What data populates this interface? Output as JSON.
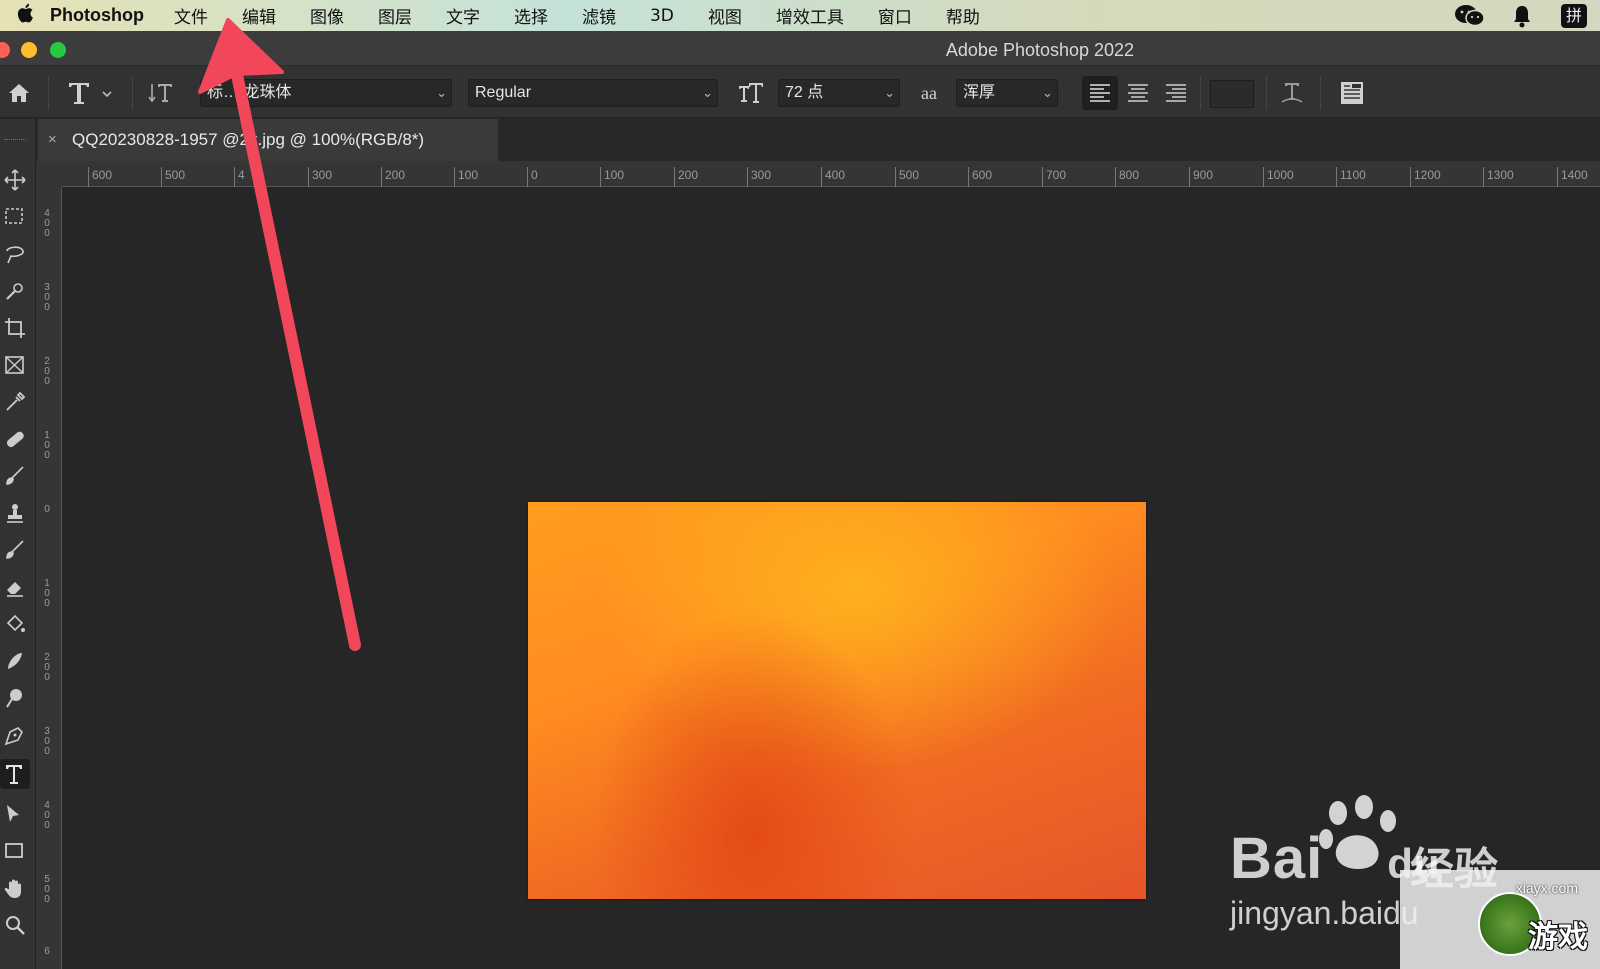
{
  "menubar": {
    "apple_icon": "apple-logo-icon",
    "app_name": "Photoshop",
    "items": [
      "文件",
      "编辑",
      "图像",
      "图层",
      "文字",
      "选择",
      "滤镜",
      "3D",
      "视图",
      "增效工具",
      "窗口",
      "帮助"
    ],
    "right_icons": [
      "wechat-icon",
      "notification-bell-icon",
      "input-method-icon"
    ],
    "input_method_label": "拼"
  },
  "window": {
    "title": "Adobe Photoshop 2022"
  },
  "options_bar": {
    "font_family": "标… 龙珠体",
    "font_style": "Regular",
    "font_size": "72 点",
    "anti_alias_label": "aa",
    "anti_alias": "浑厚",
    "text_color": "#2b2b2b"
  },
  "document_tab": {
    "close_label": "×",
    "title": "QQ20230828-1957 @2x.jpg @ 100%(RGB/8*)"
  },
  "rulers": {
    "horizontal": [
      "600",
      "500",
      "4",
      "300",
      "200",
      "100",
      "0",
      "100",
      "200",
      "300",
      "400",
      "500",
      "600",
      "700",
      "800",
      "900",
      "1000",
      "1100",
      "1200",
      "1300",
      "1400"
    ],
    "vertical": [
      "400",
      "300",
      "200",
      "100",
      "0",
      "100",
      "200",
      "300",
      "400",
      "500",
      "6"
    ]
  },
  "canvas": {
    "image_colors": [
      "#ff9d1e",
      "#f16a22",
      "#e5552a"
    ]
  },
  "watermark": {
    "baidu": "Bai",
    "du": "du",
    "jingyan": "经验",
    "url": "jingyan.baidu",
    "site": "xiayx.com",
    "game": "游戏"
  },
  "annotation": {
    "type": "arrow",
    "color": "#f2475a",
    "points_to": "文件"
  }
}
